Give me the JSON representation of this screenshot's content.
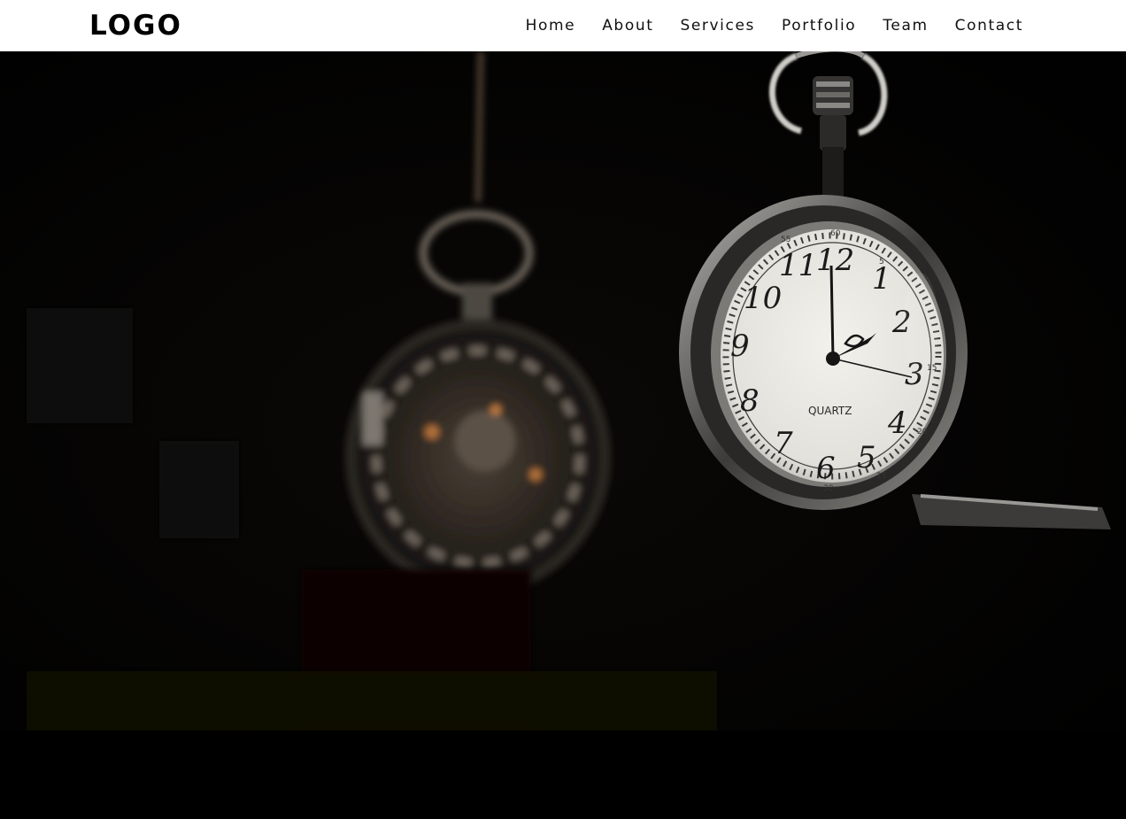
{
  "header": {
    "logo": "LOGO",
    "nav": [
      {
        "label": "Home"
      },
      {
        "label": "About"
      },
      {
        "label": "Services"
      },
      {
        "label": "Portfolio"
      },
      {
        "label": "Team"
      },
      {
        "label": "Contact"
      }
    ]
  },
  "hero": {
    "image": "pocket-watches-photo",
    "watch_dial_text": {
      "numerals": [
        "12",
        "1",
        "2",
        "3",
        "4",
        "5",
        "6",
        "7",
        "8",
        "9",
        "10",
        "11"
      ],
      "brand": "QUARTZ",
      "minute_marks": [
        "55",
        "60",
        "5",
        "10",
        "15",
        "20",
        "25",
        "30"
      ]
    }
  },
  "colors": {
    "nav_background": "#ffffff",
    "hero_background": "#030303",
    "dial": "#ecebe6",
    "metal": "#8a8a88",
    "footer": "#000000"
  }
}
